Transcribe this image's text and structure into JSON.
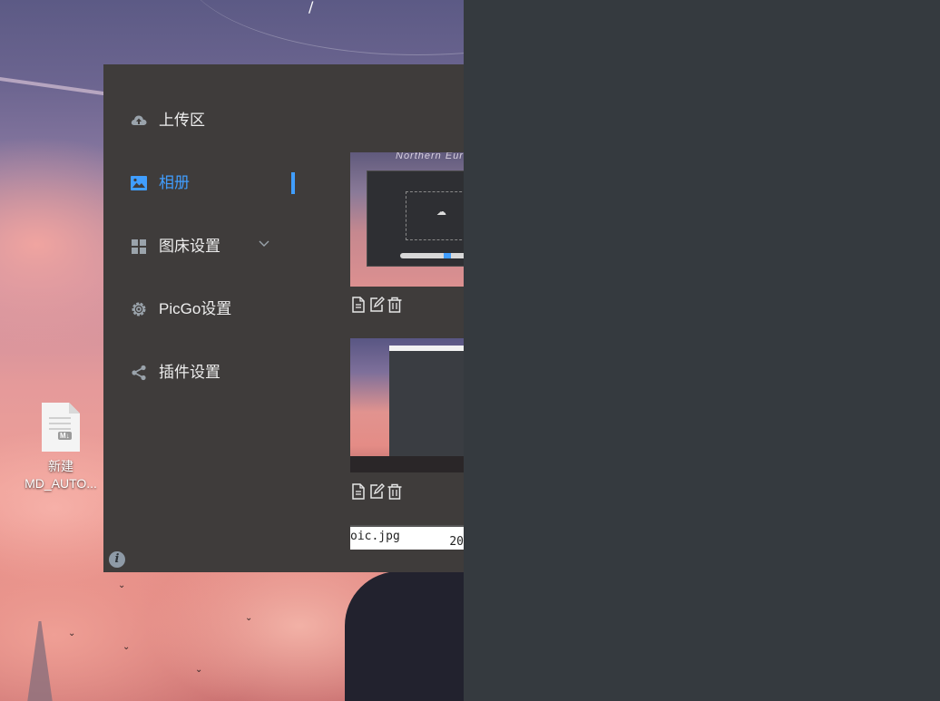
{
  "desktop": {
    "top_glyph": "/",
    "file": {
      "name_line1": "新建",
      "name_line2": "MD_AUTO...",
      "badge": "M↓"
    }
  },
  "sidebar": {
    "items": [
      {
        "label": "上传区",
        "icon": "cloud-upload-icon",
        "active": false
      },
      {
        "label": "相册",
        "icon": "picture-icon",
        "active": true
      },
      {
        "label": "图床设置",
        "icon": "grid-icon",
        "active": false,
        "expandable": true
      },
      {
        "label": "PicGo设置",
        "icon": "gear-icon",
        "active": false
      },
      {
        "label": "插件设置",
        "icon": "share-icon",
        "active": false
      }
    ],
    "info_glyph": "i"
  },
  "gallery": {
    "items": [
      {
        "thumb_heading": "Northern Euro",
        "actions": [
          "copy-icon",
          "edit-icon",
          "delete-icon"
        ]
      },
      {
        "actions": [
          "copy-icon",
          "edit-icon",
          "delete-icon"
        ]
      },
      {
        "filename": "oic.jpg",
        "year": "20"
      }
    ]
  },
  "colors": {
    "accent": "#409eff",
    "window_bg": "#3f3c3b",
    "right_bg": "#353a3f",
    "text": "#eeeeee"
  }
}
